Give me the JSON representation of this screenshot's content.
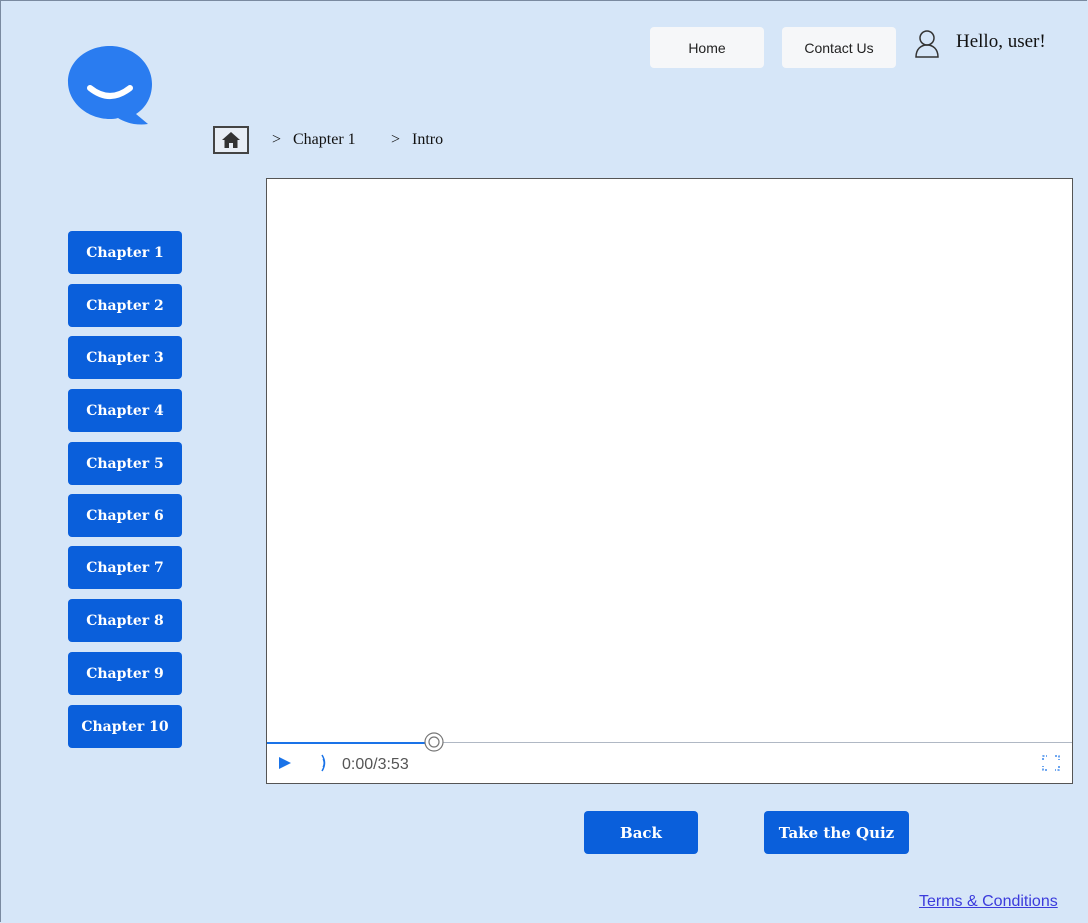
{
  "header": {
    "home_label": "Home",
    "contact_label": "Contact Us",
    "greeting": "Hello, user!"
  },
  "breadcrumb": {
    "sep1": ">",
    "item1": "Chapter 1",
    "sep2": ">",
    "item2": "Intro"
  },
  "sidebar": {
    "chapters": [
      "Chapter 1",
      "Chapter 2",
      "Chapter 3",
      "Chapter 4",
      "Chapter 5",
      "Chapter 6",
      "Chapter 7",
      "Chapter 8",
      "Chapter 9",
      "Chapter 10"
    ]
  },
  "video": {
    "time": "0:00/3:53",
    "progress_fraction": 0.208
  },
  "actions": {
    "back_label": "Back",
    "quiz_label": "Take the Quiz"
  },
  "footer": {
    "terms_label": "Terms & Conditions"
  },
  "colors": {
    "background": "#d6e6f8",
    "primary": "#0a5fdb",
    "logo": "#2a7cf0",
    "link": "#3b3bdc"
  },
  "icons": [
    "chat-bubble-logo-icon",
    "user-icon",
    "home-icon",
    "play-icon",
    "volume-icon",
    "fullscreen-icon",
    "scrubber-icon"
  ]
}
